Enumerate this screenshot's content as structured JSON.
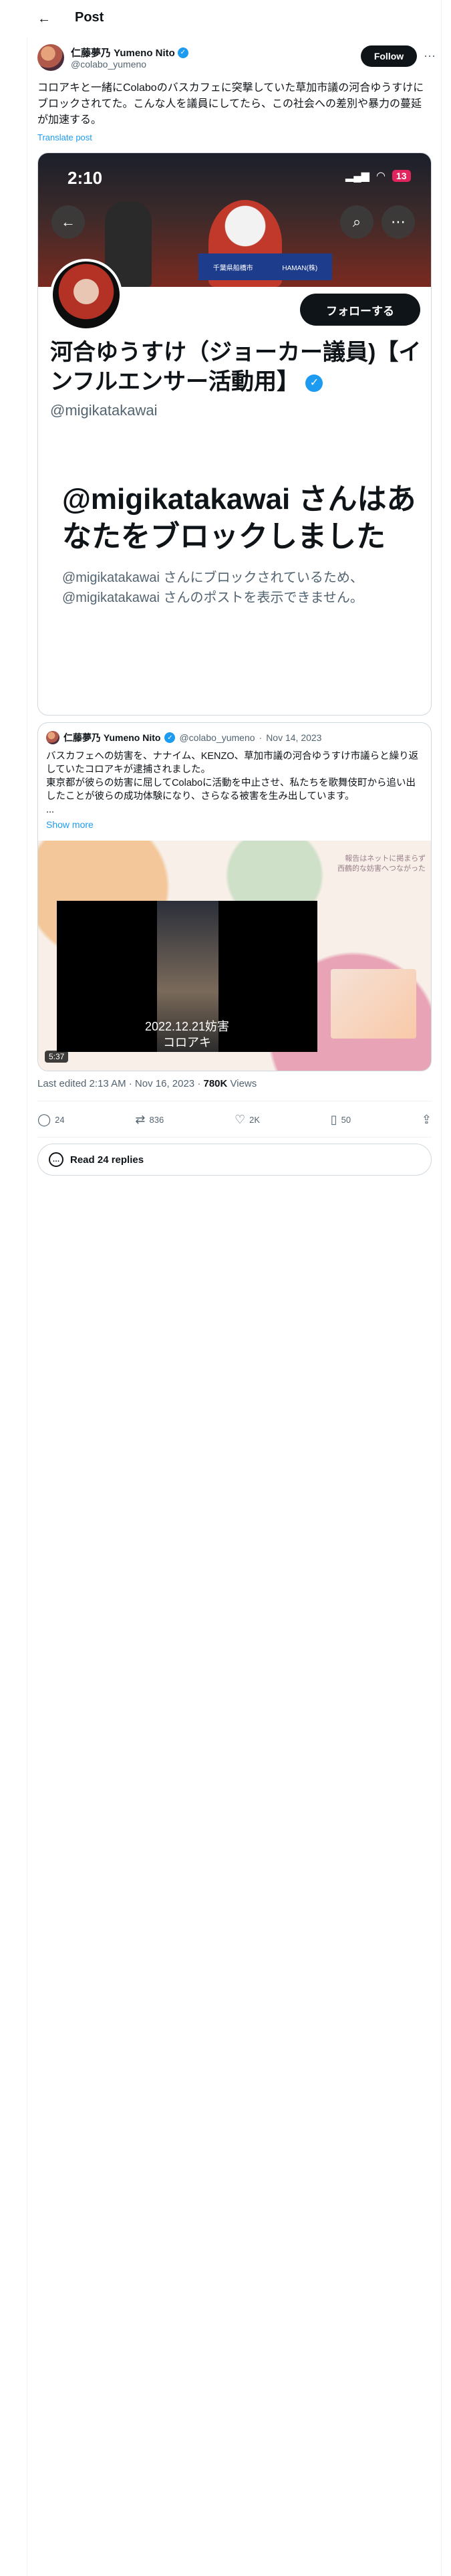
{
  "header": {
    "back_icon": "arrow-left-icon",
    "title": "Post"
  },
  "author": {
    "name": "仁藤夢乃 Yumeno Nito",
    "handle": "@colabo_yumeno",
    "follow_label": "Follow",
    "more_icon": "ellipsis-icon"
  },
  "tweet": {
    "text": "コロアキと一緒にColaboのバスカフェに突撃していた草加市議の河合ゆうすけにブロックされてた。こんな人を議員にしてたら、この社会への差別や暴力の蔓延が加速する。",
    "translate_label": "Translate post"
  },
  "media": {
    "status_time": "2:10",
    "battery": "13",
    "plate_left": "千葉県船橋市",
    "plate_right": "HAMAN(株)",
    "follow_label": "フォローする",
    "profile_name": "河合ゆうすけ（ジョーカー議員)【インフルエンサー活動用】",
    "profile_handle": "@migikatakawai",
    "blocked_title": "@migikatakawai さんはあなたをブロックしました",
    "blocked_sub": "@migikatakawai さんにブロックされているため、@migikatakawai さんのポストを表示できません。"
  },
  "quote": {
    "name": "仁藤夢乃 Yumeno Nito",
    "handle": "@colabo_yumeno",
    "date": "Nov 14, 2023",
    "text": "バスカフェへの妨害を、ナナイム、KENZO、草加市議の河合ゆうすけ市議らと繰り返していたコロアキが逮捕されました。\n東京都が彼らの妨害に屈してColaboに活動を中止させ、私たちを歌舞伎町から追い出したことが彼らの成功体験になり、さらなる被害を生み出しています。\n...",
    "show_more": "Show more",
    "video_caption": "2022.12.21妨害\nコロアキ",
    "side_text": "報告はネットに掲まらず\n西鶴的な妨害へつながった",
    "duration": "5:37"
  },
  "meta": {
    "edited_prefix": "Last edited 2:13 AM · Nov 16, 2023 · ",
    "views_count": "780K",
    "views_label": " Views"
  },
  "actions": {
    "replies": "24",
    "reposts": "836",
    "likes": "2K",
    "bookmarks": "50"
  },
  "read_replies": "Read 24 replies",
  "colors": {
    "accent": "#1d9bf0",
    "text": "#0f1419",
    "muted": "#536471",
    "border": "#cfd9de"
  }
}
